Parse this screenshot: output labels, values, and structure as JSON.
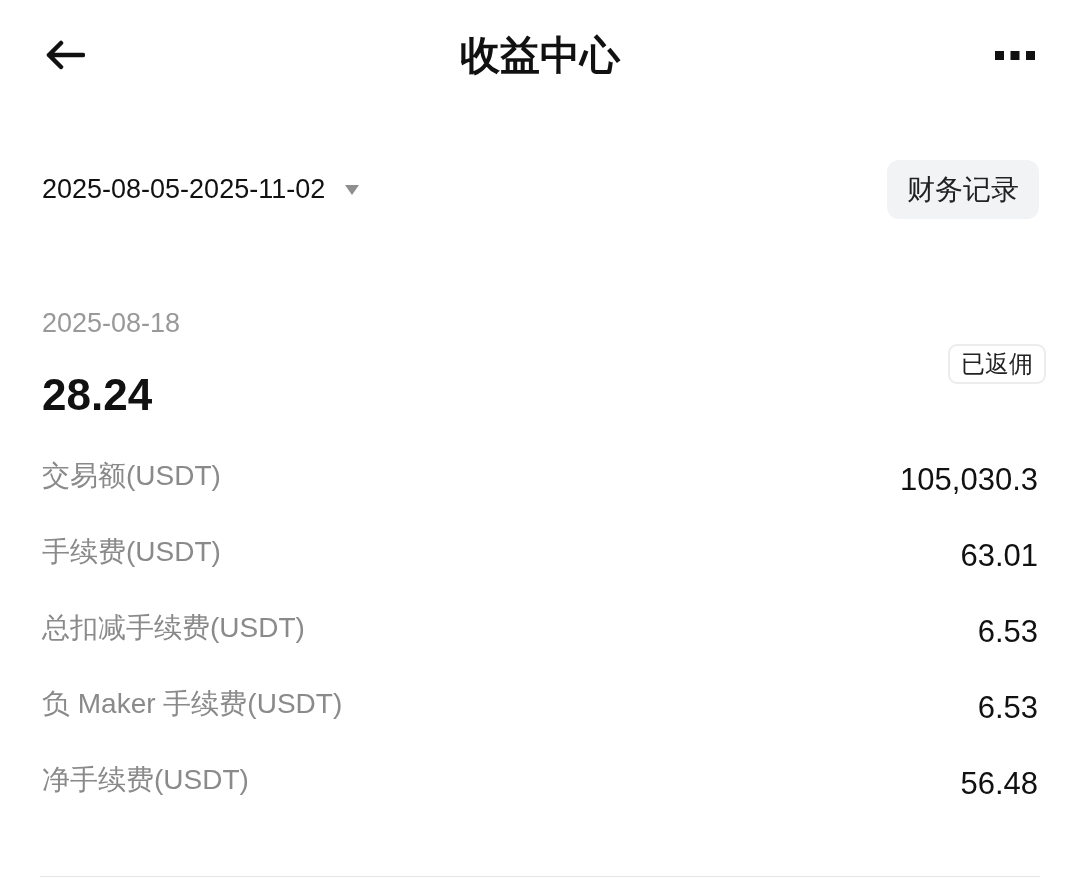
{
  "header": {
    "title": "收益中心"
  },
  "filter": {
    "date_range": "2025-08-05-2025-11-02",
    "records_button": "财务记录"
  },
  "record": {
    "date": "2025-08-18",
    "amount": "28.24",
    "status": "已返佣",
    "rows": [
      {
        "label": "交易额(USDT)",
        "value": "105,030.3"
      },
      {
        "label": "手续费(USDT)",
        "value": "63.01"
      },
      {
        "label": "总扣减手续费(USDT)",
        "value": "6.53"
      },
      {
        "label": "负 Maker 手续费(USDT)",
        "value": "6.53"
      },
      {
        "label": "净手续费(USDT)",
        "value": "56.48"
      }
    ]
  }
}
